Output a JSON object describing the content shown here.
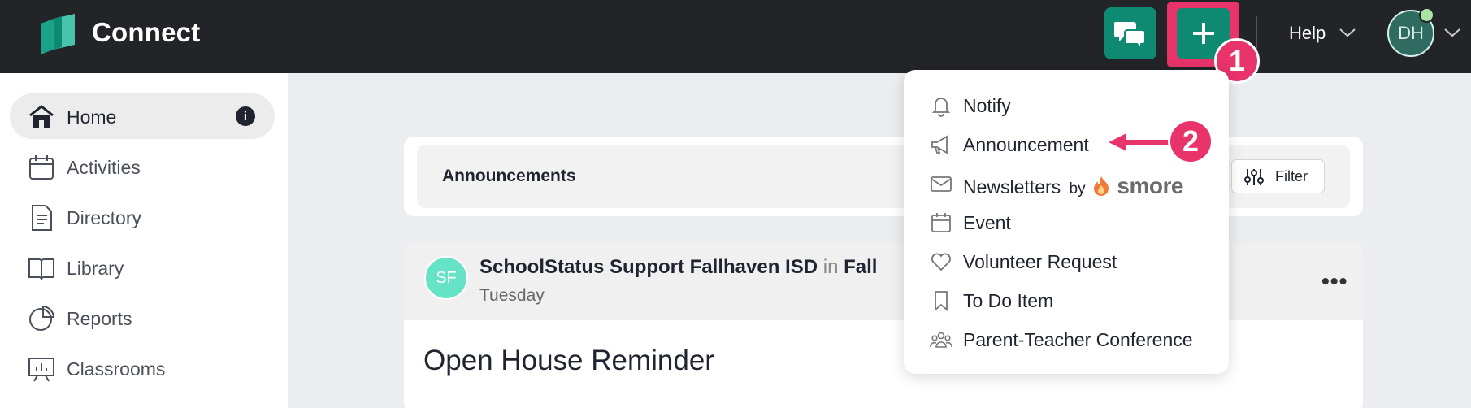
{
  "app": {
    "brand": "Connect",
    "help_label": "Help",
    "user_initials": "DH"
  },
  "colors": {
    "topbar": "#222428",
    "accent_green": "#0e8a72",
    "highlight_pink": "#e8336b"
  },
  "annotations": {
    "step1": "1",
    "step2": "2"
  },
  "sidebar": {
    "items": [
      {
        "label": "Home",
        "icon": "home-icon",
        "active": true
      },
      {
        "label": "Activities",
        "icon": "calendar-icon"
      },
      {
        "label": "Directory",
        "icon": "document-icon"
      },
      {
        "label": "Library",
        "icon": "book-icon"
      },
      {
        "label": "Reports",
        "icon": "pie-chart-icon"
      },
      {
        "label": "Classrooms",
        "icon": "classroom-board-icon"
      }
    ]
  },
  "announcements": {
    "title": "Announcements",
    "filter_label": "Filter"
  },
  "post": {
    "avatar_initials": "SF",
    "author": "SchoolStatus Support Fallhaven ISD",
    "in_word": "in",
    "channel": "Fall",
    "day": "Tuesday",
    "title": "Open House Reminder",
    "more": "•••"
  },
  "create_menu": {
    "items": [
      {
        "label": "Notify",
        "icon": "bell-icon"
      },
      {
        "label": "Announcement",
        "icon": "megaphone-icon"
      },
      {
        "label": "Newsletters",
        "by": "by",
        "brand": "smore",
        "icon": "envelope-icon"
      },
      {
        "label": "Event",
        "icon": "calendar-icon"
      },
      {
        "label": "Volunteer Request",
        "icon": "heart-icon"
      },
      {
        "label": "To Do Item",
        "icon": "bookmark-icon"
      },
      {
        "label": "Parent-Teacher Conference",
        "icon": "people-icon"
      }
    ]
  }
}
